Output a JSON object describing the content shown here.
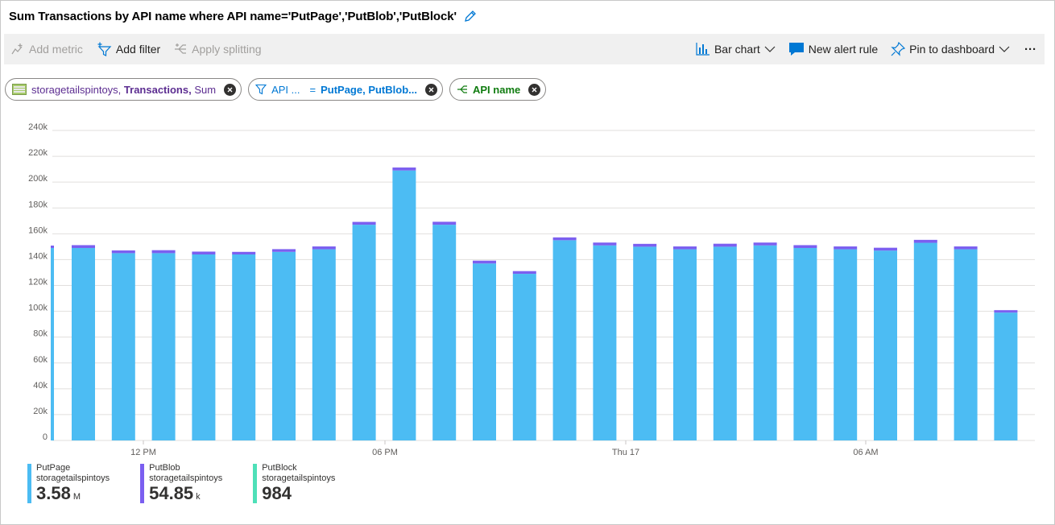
{
  "title": "Sum Transactions by API name where API name='PutPage','PutBlob','PutBlock'",
  "toolbar": {
    "add_metric": "Add metric",
    "add_filter": "Add filter",
    "apply_splitting": "Apply splitting",
    "chart_type": "Bar chart",
    "new_alert_rule": "New alert rule",
    "pin_to_dashboard": "Pin to dashboard",
    "more": "···"
  },
  "pills": {
    "metric": {
      "resource": "storagetailspintoys,",
      "metric": "Transactions,",
      "aggregation": "Sum"
    },
    "filter": {
      "property": "API ...",
      "operator": "=",
      "values": "PutPage, PutBlob..."
    },
    "splitting": {
      "property": "API name"
    }
  },
  "colors": {
    "putpage": "#4cbcf3",
    "putblob": "#7b5ff0",
    "putblock": "#4ee0b8",
    "gridline": "#e1dfdd",
    "axis_text": "#605e5c"
  },
  "chart_data": {
    "type": "bar",
    "stacked": true,
    "y_ticks": [
      "0",
      "20k",
      "40k",
      "60k",
      "80k",
      "100k",
      "120k",
      "140k",
      "160k",
      "180k",
      "200k",
      "220k",
      "240k"
    ],
    "ylim": [
      0,
      240000
    ],
    "x_tick_labels": [
      "12 PM",
      "06 PM",
      "Thu 17",
      "06 AM"
    ],
    "grid": true,
    "legend_position": "bottom-left",
    "series": [
      {
        "name": "PutPage",
        "values": [
          149000,
          145000,
          145000,
          144000,
          144000,
          146000,
          148000,
          167000,
          209000,
          167000,
          137000,
          129000,
          155000,
          151000,
          150000,
          148000,
          150000,
          151000,
          149000,
          148000,
          147000,
          153000,
          148000,
          99000
        ]
      },
      {
        "name": "PutBlob",
        "values": [
          2200,
          2100,
          2300,
          2200,
          2000,
          2100,
          2200,
          2200,
          2300,
          2300,
          2200,
          2100,
          2200,
          2200,
          2200,
          2200,
          2300,
          2200,
          2200,
          2200,
          2200,
          2300,
          2200,
          1800
        ]
      },
      {
        "name": "PutBlock",
        "values": [
          40,
          40,
          40,
          40,
          40,
          40,
          40,
          40,
          40,
          40,
          40,
          40,
          40,
          40,
          40,
          40,
          40,
          40,
          40,
          40,
          40,
          40,
          40,
          40
        ]
      }
    ],
    "partial_first_bar": {
      "putpage": 149000,
      "putblob": 2200
    }
  },
  "legend": [
    {
      "name": "PutPage",
      "resource": "storagetailspintoys",
      "value": "3.58",
      "unit": "M"
    },
    {
      "name": "PutBlob",
      "resource": "storagetailspintoys",
      "value": "54.85",
      "unit": "k"
    },
    {
      "name": "PutBlock",
      "resource": "storagetailspintoys",
      "value": "984",
      "unit": ""
    }
  ]
}
